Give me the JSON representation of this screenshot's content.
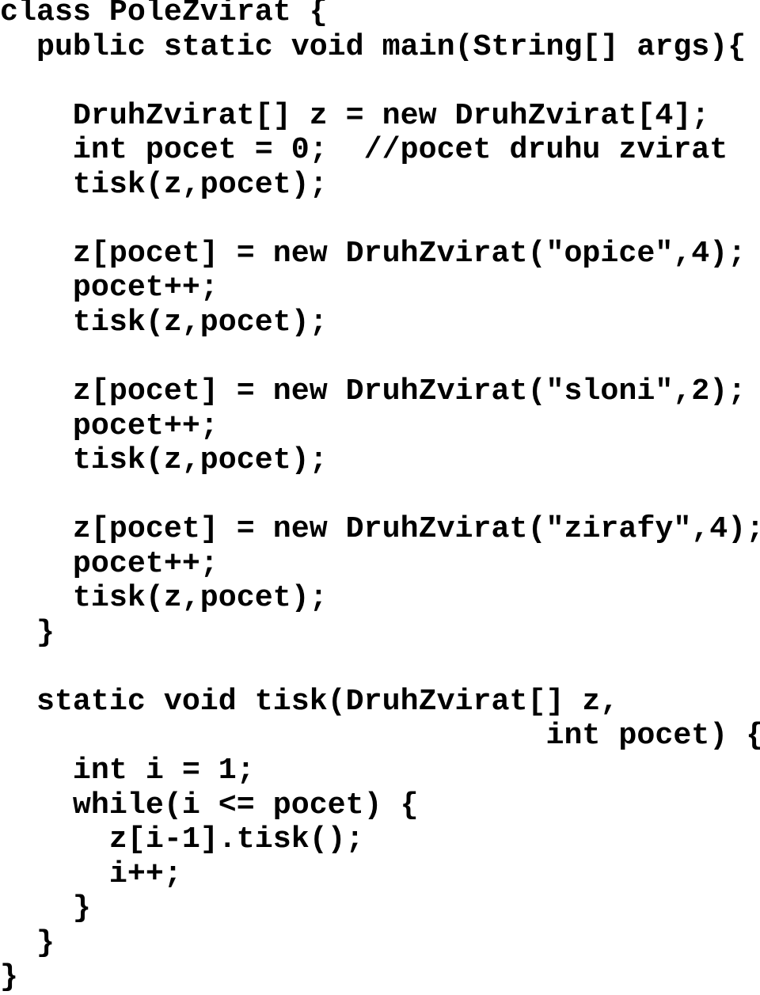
{
  "code": {
    "language": "Java",
    "lines": [
      "class PoleZvirat {",
      "  public static void main(String[] args){",
      "",
      "    DruhZvirat[] z = new DruhZvirat[4];",
      "    int pocet = 0;  //pocet druhu zvirat",
      "    tisk(z,pocet);",
      "",
      "    z[pocet] = new DruhZvirat(\"opice\",4);",
      "    pocet++;",
      "    tisk(z,pocet);",
      "",
      "    z[pocet] = new DruhZvirat(\"sloni\",2);",
      "    pocet++;",
      "    tisk(z,pocet);",
      "",
      "    z[pocet] = new DruhZvirat(\"zirafy\",4);",
      "    pocet++;",
      "    tisk(z,pocet);",
      "  }",
      "",
      "  static void tisk(DruhZvirat[] z,",
      "                              int pocet) {",
      "    int i = 1;",
      "    while(i <= pocet) {",
      "      z[i-1].tisk();",
      "      i++;",
      "    }",
      "  }",
      "}"
    ]
  }
}
